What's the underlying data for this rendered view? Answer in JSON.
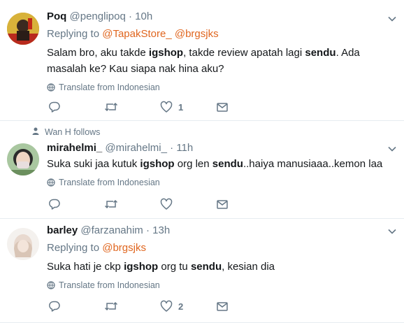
{
  "tweets": [
    {
      "display_name": "Poq",
      "handle": "@penglipoq",
      "sep": "·",
      "time": "10h",
      "replying_label": "Replying to",
      "replying_to": [
        "@TapakStore_",
        "@brgsjks"
      ],
      "text_parts": [
        [
          "Salam bro, aku takde ",
          false
        ],
        [
          "igshop",
          true
        ],
        [
          ", takde review apatah lagi ",
          false
        ],
        [
          "sendu",
          true
        ],
        [
          ". Ada masalah ke? Kau siapa nak hina aku?",
          false
        ]
      ],
      "translate": "Translate from Indonesian",
      "like_count": "1"
    },
    {
      "social_context": "Wan H follows",
      "display_name": "mirahelmi_",
      "handle": "@mirahelmi_",
      "sep": "·",
      "time": "11h",
      "text_parts": [
        [
          "Suka suki jaa kutuk ",
          false
        ],
        [
          "igshop",
          true
        ],
        [
          " org len ",
          false
        ],
        [
          "sendu",
          true
        ],
        [
          "..haiya manusiaaa..kemon laa",
          false
        ]
      ],
      "translate": "Translate from Indonesian",
      "like_count": ""
    },
    {
      "display_name": "barley",
      "handle": "@farzanahim",
      "sep": "·",
      "time": "13h",
      "replying_label": "Replying to",
      "replying_to": [
        "@brgsjks"
      ],
      "text_parts": [
        [
          "Suka hati je ckp ",
          false
        ],
        [
          "igshop",
          true
        ],
        [
          " org tu ",
          false
        ],
        [
          "sendu",
          true
        ],
        [
          ", kesian dia",
          false
        ]
      ],
      "translate": "Translate from Indonesian",
      "like_count": "2"
    }
  ],
  "icons": {
    "reply": "reply-icon",
    "retweet": "retweet-icon",
    "like": "heart-icon",
    "dm": "envelope-icon",
    "more": "chevron-down-icon",
    "globe": "globe-icon",
    "person": "person-icon"
  },
  "colors": {
    "link": "#e0661f",
    "secondary_text": "#657786",
    "divider": "#e6ecf0"
  }
}
